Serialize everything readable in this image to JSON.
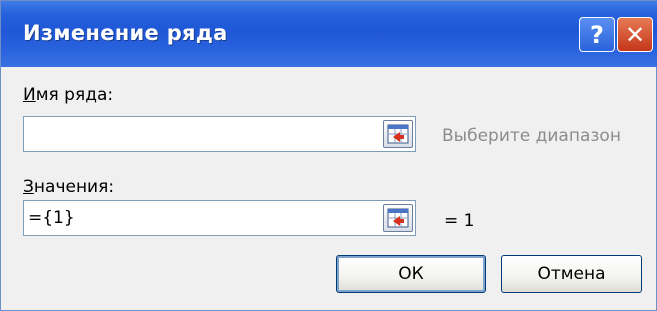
{
  "window": {
    "title": "Изменение ряда",
    "help_glyph": "?",
    "close_glyph": "✕"
  },
  "series_name": {
    "label_prefix": "И",
    "label_rest": "мя ряда:",
    "value": "",
    "hint": "Выберите диапазон"
  },
  "series_values": {
    "label_prefix": "З",
    "label_rest": "начения:",
    "value": "={1}",
    "preview": "= 1"
  },
  "buttons": {
    "ok": "ОК",
    "cancel": "Отмена"
  },
  "colors": {
    "titlebar": "#2763dc",
    "close": "#c4361a",
    "hint_text": "#8c8c8c"
  }
}
